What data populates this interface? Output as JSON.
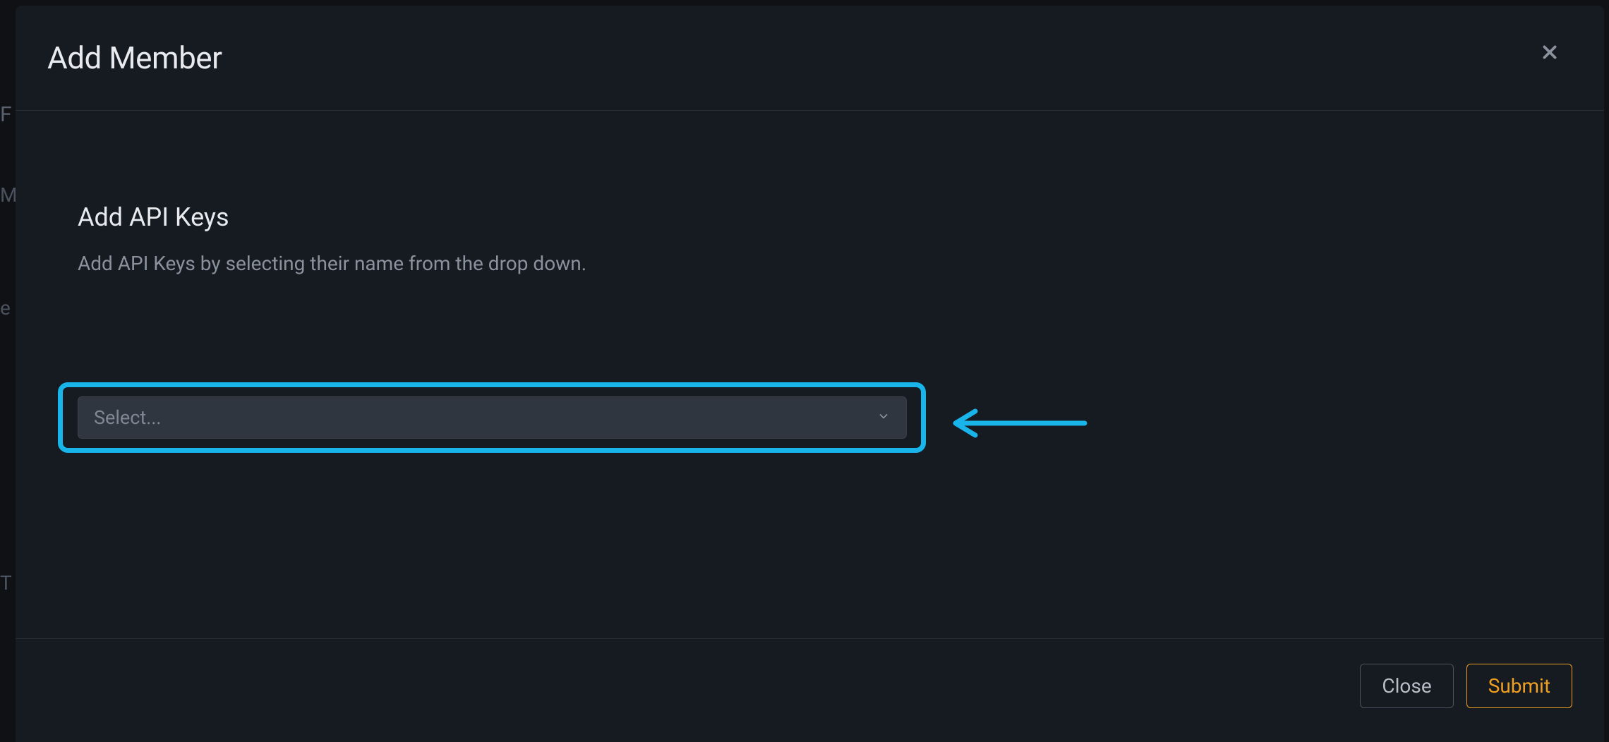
{
  "modal": {
    "title": "Add Member",
    "sections": {
      "apikeys": {
        "title": "Add API Keys",
        "description": "Add API Keys by selecting their name from the drop down.",
        "select_placeholder": "Select..."
      }
    },
    "footer": {
      "close_label": "Close",
      "submit_label": "Submit"
    }
  },
  "annotation": {
    "highlight_color": "#19b5ea"
  }
}
